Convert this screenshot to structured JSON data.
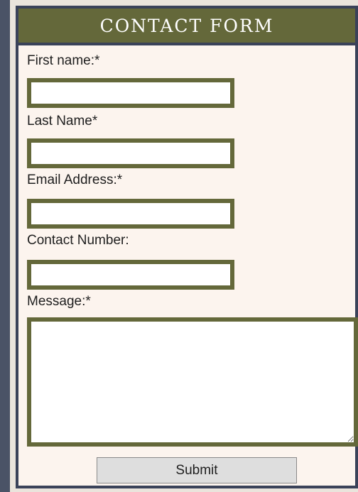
{
  "form": {
    "title": "CONTACT FORM",
    "fields": {
      "first_name": {
        "label": "First name:*",
        "value": ""
      },
      "last_name": {
        "label": "Last Name*",
        "value": ""
      },
      "email": {
        "label": "Email Address:*",
        "value": ""
      },
      "contact_number": {
        "label": "Contact Number:",
        "value": ""
      },
      "message": {
        "label": "Message:*",
        "value": ""
      }
    },
    "submit_label": "Submit"
  },
  "colors": {
    "page_background": "#4a5366",
    "panel_background": "#fcf4ee",
    "header_background": "#64683a",
    "input_border": "#64683a",
    "panel_border": "#3a4259"
  }
}
